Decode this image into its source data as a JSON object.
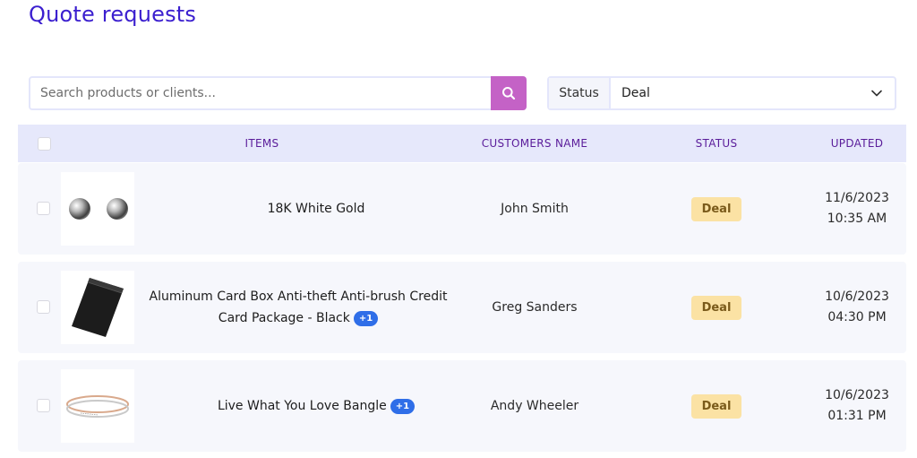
{
  "page": {
    "title": "Quote requests"
  },
  "search": {
    "placeholder": "Search products or clients...",
    "value": "",
    "button_icon": "search-icon",
    "button_color": "#c462c6"
  },
  "filter": {
    "label": "Status",
    "selected": "Deal",
    "icon": "chevron-down-icon"
  },
  "table": {
    "columns": [
      "ITEMS",
      "CUSTOMERS NAME",
      "STATUS",
      "UPDATED"
    ],
    "rows": [
      {
        "item": "18K White Gold",
        "extra_count": "",
        "thumbnail": "silver-ball-earrings",
        "customer": "John Smith",
        "status": "Deal",
        "date": "11/6/2023",
        "time": "10:35 AM"
      },
      {
        "item": "Aluminum Card Box Anti-theft Anti-brush Credit Card Package - Black",
        "extra_count": "+1",
        "thumbnail": "black-card-box",
        "customer": "Greg Sanders",
        "status": "Deal",
        "date": "10/6/2023",
        "time": "04:30 PM"
      },
      {
        "item": "Live What You Love Bangle",
        "extra_count": "+1",
        "thumbnail": "bangle-bracelets",
        "customer": "Andy Wheeler",
        "status": "Deal",
        "date": "10/6/2023",
        "time": "01:31 PM"
      }
    ]
  },
  "colors": {
    "title": "#3b1fcf",
    "header_bg": "#e6e8fb",
    "header_text": "#5a1c9a",
    "status_badge_bg": "#fbe2a4",
    "count_badge_bg": "#2f6ee8"
  }
}
